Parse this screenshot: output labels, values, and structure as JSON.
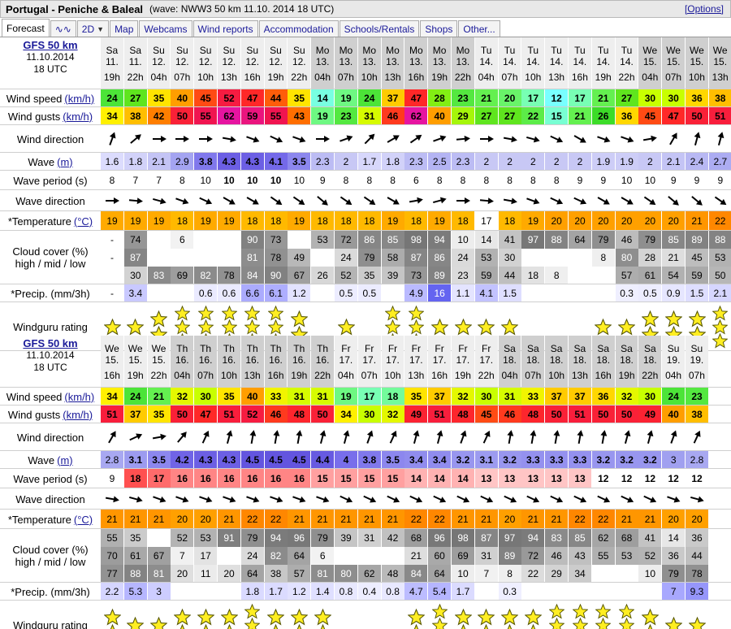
{
  "header": {
    "spot": "Portugal - Peniche & Baleal",
    "info": "(wave: NWW3 50 km 11.10. 2014 18 UTC)",
    "options": "[Options]"
  },
  "tabs": [
    {
      "label": "Forecast",
      "active": true
    },
    {
      "label": "∿∿",
      "icon": "wave-graph-icon"
    },
    {
      "label": "2D",
      "caret": true
    },
    {
      "label": "Map"
    },
    {
      "label": "Webcams"
    },
    {
      "label": "Wind reports"
    },
    {
      "label": "Accommodation"
    },
    {
      "label": "Schools/Rentals"
    },
    {
      "label": "Shops"
    },
    {
      "label": "Other..."
    }
  ],
  "labels": {
    "wind_speed": "Wind speed",
    "wind_gusts": "Wind gusts",
    "unit_kmh": "(km/h)",
    "wind_direction": "Wind direction",
    "wave": "Wave",
    "unit_m": "(m)",
    "wave_period": "Wave period (s)",
    "wave_direction": "Wave direction",
    "temperature": "*Temperature",
    "unit_c": "(°C)",
    "cloud_line1": "Cloud cover (%)",
    "cloud_line2": "high / mid / low",
    "precip": "*Precip. (mm/3h)",
    "rating": "Windguru rating"
  },
  "sections": [
    {
      "model": "GFS 50 km",
      "date": "11.10.2014",
      "utc": "18 UTC",
      "days": [
        "Sa",
        "Sa",
        "Su",
        "Su",
        "Su",
        "Su",
        "Su",
        "Su",
        "Su",
        "Mo",
        "Mo",
        "Mo",
        "Mo",
        "Mo",
        "Mo",
        "Mo",
        "Tu",
        "Tu",
        "Tu",
        "Tu",
        "Tu",
        "Tu",
        "Tu",
        "We",
        "We",
        "We",
        "We"
      ],
      "dates": [
        "11.",
        "11.",
        "12.",
        "12.",
        "12.",
        "12.",
        "12.",
        "12.",
        "12.",
        "13.",
        "13.",
        "13.",
        "13.",
        "13.",
        "13.",
        "13.",
        "14.",
        "14.",
        "14.",
        "14.",
        "14.",
        "14.",
        "14.",
        "15.",
        "15.",
        "15.",
        "15."
      ],
      "hours": [
        "19h",
        "22h",
        "04h",
        "07h",
        "10h",
        "13h",
        "16h",
        "19h",
        "22h",
        "04h",
        "07h",
        "10h",
        "13h",
        "16h",
        "19h",
        "22h",
        "04h",
        "07h",
        "10h",
        "13h",
        "16h",
        "19h",
        "22h",
        "04h",
        "07h",
        "10h",
        "13h"
      ],
      "night": [
        false,
        false,
        false,
        false,
        false,
        false,
        false,
        false,
        false,
        true,
        true,
        true,
        true,
        true,
        true,
        true,
        false,
        false,
        false,
        false,
        false,
        false,
        false,
        true,
        true,
        true,
        true
      ],
      "wind_speed": [
        24,
        27,
        35,
        40,
        45,
        52,
        47,
        44,
        35,
        14,
        19,
        24,
        37,
        47,
        28,
        23,
        21,
        20,
        17,
        12,
        17,
        21,
        27,
        30,
        30,
        36,
        38
      ],
      "wind_gusts": [
        34,
        38,
        42,
        50,
        55,
        62,
        59,
        55,
        43,
        19,
        23,
        31,
        46,
        62,
        40,
        29,
        27,
        27,
        22,
        15,
        21,
        26,
        36,
        45,
        47,
        50,
        51
      ],
      "wind_dir": [
        20,
        50,
        90,
        90,
        90,
        100,
        110,
        115,
        110,
        90,
        70,
        45,
        60,
        55,
        70,
        85,
        90,
        100,
        105,
        115,
        120,
        110,
        110,
        80,
        30,
        15,
        15
      ],
      "wave": [
        "1.6",
        "1.8",
        "2.1",
        "2.9",
        "3.8",
        "4.3",
        "4.3",
        "4.1",
        "3.5",
        "2.3",
        "2",
        "1.7",
        "1.8",
        "2.3",
        "2.5",
        "2.3",
        "2",
        "2",
        "2",
        "2",
        "2",
        "1.9",
        "1.9",
        "2",
        "2.1",
        "2.4",
        "2.7"
      ],
      "wave_bold": [
        false,
        false,
        false,
        false,
        true,
        true,
        true,
        true,
        true,
        false,
        false,
        false,
        false,
        false,
        false,
        false,
        false,
        false,
        false,
        false,
        false,
        false,
        false,
        false,
        false,
        false,
        false
      ],
      "wave_period": [
        "8",
        "7",
        "7",
        "8",
        "10",
        "10",
        "10",
        "10",
        "10",
        "9",
        "8",
        "8",
        "8",
        "6",
        "8",
        "8",
        "8",
        "8",
        "8",
        "8",
        "9",
        "9",
        "10",
        "10",
        "9",
        "9",
        "9"
      ],
      "period_bold": [
        false,
        false,
        false,
        false,
        false,
        true,
        true,
        true,
        false,
        false,
        false,
        false,
        false,
        false,
        false,
        false,
        false,
        false,
        false,
        false,
        false,
        false,
        false,
        false,
        false,
        false,
        false
      ],
      "wave_dir": [
        90,
        95,
        105,
        110,
        115,
        120,
        120,
        125,
        125,
        130,
        125,
        125,
        120,
        80,
        75,
        90,
        95,
        100,
        110,
        115,
        115,
        120,
        120,
        125,
        130,
        130,
        125
      ],
      "temperature": [
        19,
        19,
        19,
        18,
        19,
        19,
        18,
        18,
        19,
        18,
        18,
        18,
        19,
        18,
        19,
        18,
        17,
        18,
        19,
        20,
        20,
        20,
        20,
        20,
        20,
        21,
        22
      ],
      "cloud_high": [
        "-",
        "74",
        "",
        "6",
        "",
        "",
        "90",
        "73",
        "",
        "53",
        "72",
        "86",
        "85",
        "98",
        "94",
        "10",
        "14",
        "41",
        "97",
        "88",
        "64",
        "79",
        "46",
        "79",
        "85",
        "89",
        "88"
      ],
      "cloud_mid": [
        "-",
        "87",
        "",
        "",
        "",
        "",
        "81",
        "78",
        "49",
        "",
        "24",
        "79",
        "58",
        "87",
        "86",
        "24",
        "53",
        "30",
        "",
        "",
        "",
        "8",
        "80",
        "28",
        "21",
        "45",
        "53"
      ],
      "cloud_low": [
        "",
        "30",
        "83",
        "69",
        "82",
        "78",
        "84",
        "90",
        "67",
        "26",
        "52",
        "35",
        "39",
        "73",
        "89",
        "23",
        "59",
        "44",
        "18",
        "8",
        "",
        "",
        "57",
        "61",
        "54",
        "59",
        "50"
      ],
      "precip": [
        "-",
        "3.4",
        "",
        "",
        "0.6",
        "0.6",
        "6.6",
        "6.1",
        "1.2",
        "",
        "0.5",
        "0.5",
        "",
        "4.9",
        "16",
        "1.1",
        "4.1",
        "1.5",
        "",
        "",
        "",
        "",
        "0.3",
        "0.5",
        "0.9",
        "1.5",
        "2.1"
      ],
      "rating": [
        1,
        1,
        2,
        3,
        3,
        3,
        3,
        3,
        2,
        0,
        1,
        0,
        3,
        3,
        1,
        1,
        1,
        1,
        0,
        0,
        0,
        1,
        1,
        2,
        2,
        2,
        3
      ]
    },
    {
      "model": "GFS 50 km",
      "date": "11.10.2014",
      "utc": "18 UTC",
      "days": [
        "We",
        "We",
        "We",
        "Th",
        "Th",
        "Th",
        "Th",
        "Th",
        "Th",
        "Th",
        "Fr",
        "Fr",
        "Fr",
        "Fr",
        "Fr",
        "Fr",
        "Fr",
        "Sa",
        "Sa",
        "Sa",
        "Sa",
        "Sa",
        "Sa",
        "Sa",
        "Su",
        "Su"
      ],
      "dates": [
        "15.",
        "15.",
        "15.",
        "16.",
        "16.",
        "16.",
        "16.",
        "16.",
        "16.",
        "16.",
        "17.",
        "17.",
        "17.",
        "17.",
        "17.",
        "17.",
        "17.",
        "18.",
        "18.",
        "18.",
        "18.",
        "18.",
        "18.",
        "18.",
        "19.",
        "19."
      ],
      "hours": [
        "16h",
        "19h",
        "22h",
        "04h",
        "07h",
        "10h",
        "13h",
        "16h",
        "19h",
        "22h",
        "04h",
        "07h",
        "10h",
        "13h",
        "16h",
        "19h",
        "22h",
        "04h",
        "07h",
        "10h",
        "13h",
        "16h",
        "19h",
        "22h",
        "04h",
        "07h"
      ],
      "night": [
        false,
        false,
        false,
        true,
        true,
        true,
        true,
        true,
        true,
        true,
        false,
        false,
        false,
        false,
        false,
        false,
        false,
        true,
        true,
        true,
        true,
        true,
        true,
        true,
        false,
        false
      ],
      "wind_speed": [
        34,
        24,
        21,
        32,
        30,
        35,
        40,
        33,
        31,
        31,
        19,
        17,
        18,
        35,
        37,
        32,
        30,
        31,
        33,
        37,
        37,
        36,
        32,
        30,
        24,
        23
      ],
      "wind_gusts": [
        51,
        37,
        35,
        50,
        47,
        51,
        52,
        46,
        48,
        50,
        34,
        30,
        32,
        49,
        51,
        48,
        45,
        46,
        48,
        50,
        51,
        50,
        50,
        49,
        40,
        38
      ],
      "wind_dir": [
        30,
        65,
        80,
        40,
        25,
        15,
        10,
        10,
        10,
        15,
        15,
        20,
        25,
        15,
        15,
        20,
        25,
        10,
        10,
        10,
        10,
        10,
        15,
        15,
        20,
        25
      ],
      "wave": [
        "2.8",
        "3.1",
        "3.5",
        "4.2",
        "4.3",
        "4.3",
        "4.5",
        "4.5",
        "4.5",
        "4.4",
        "4",
        "3.8",
        "3.5",
        "3.4",
        "3.4",
        "3.2",
        "3.1",
        "3.2",
        "3.3",
        "3.3",
        "3.3",
        "3.2",
        "3.2",
        "3.2",
        "3",
        "2.8"
      ],
      "wave_bold": [
        false,
        true,
        true,
        true,
        true,
        true,
        true,
        true,
        true,
        true,
        true,
        true,
        true,
        true,
        true,
        true,
        true,
        true,
        true,
        true,
        true,
        true,
        true,
        true,
        false,
        false
      ],
      "wave_period": [
        "9",
        "18",
        "17",
        "16",
        "16",
        "16",
        "16",
        "16",
        "16",
        "15",
        "15",
        "15",
        "15",
        "14",
        "14",
        "14",
        "13",
        "13",
        "13",
        "13",
        "13",
        "12",
        "12",
        "12",
        "12",
        "12"
      ],
      "period_bold": [
        false,
        true,
        true,
        true,
        true,
        true,
        true,
        true,
        true,
        true,
        true,
        true,
        true,
        true,
        true,
        true,
        true,
        true,
        true,
        true,
        true,
        true,
        true,
        true,
        true,
        true
      ],
      "wave_dir": [
        100,
        105,
        110,
        110,
        110,
        110,
        110,
        110,
        110,
        110,
        115,
        115,
        115,
        115,
        115,
        115,
        115,
        115,
        115,
        115,
        115,
        115,
        115,
        115,
        110,
        105
      ],
      "temperature": [
        21,
        21,
        21,
        20,
        20,
        21,
        22,
        22,
        21,
        21,
        21,
        21,
        21,
        22,
        22,
        21,
        21,
        20,
        21,
        21,
        22,
        22,
        21,
        21,
        20,
        20
      ],
      "cloud_high": [
        "55",
        "35",
        "",
        "52",
        "53",
        "91",
        "79",
        "94",
        "96",
        "79",
        "39",
        "31",
        "42",
        "68",
        "96",
        "98",
        "87",
        "97",
        "94",
        "83",
        "85",
        "62",
        "68",
        "41",
        "14",
        "36"
      ],
      "cloud_mid": [
        "70",
        "61",
        "67",
        "7",
        "17",
        "",
        "24",
        "82",
        "64",
        "6",
        "",
        "",
        "",
        "21",
        "60",
        "69",
        "31",
        "89",
        "72",
        "46",
        "43",
        "55",
        "53",
        "52",
        "36",
        "44"
      ],
      "cloud_low": [
        "77",
        "88",
        "81",
        "20",
        "11",
        "20",
        "64",
        "38",
        "57",
        "81",
        "80",
        "62",
        "48",
        "84",
        "64",
        "10",
        "7",
        "8",
        "22",
        "29",
        "34",
        "",
        "",
        "10",
        "79",
        "78"
      ],
      "precip": [
        "2.2",
        "5.3",
        "3",
        "",
        "",
        "",
        "1.8",
        "1.7",
        "1.2",
        "1.4",
        "0.8",
        "0.4",
        "0.8",
        "4.7",
        "5.4",
        "1.7",
        "",
        "0.3",
        "",
        "",
        "",
        "",
        "",
        "",
        "7",
        "9.3"
      ],
      "rating": [
        2,
        1,
        1,
        2,
        2,
        2,
        3,
        2,
        2,
        2,
        0,
        0,
        0,
        2,
        3,
        2,
        2,
        2,
        2,
        3,
        3,
        3,
        3,
        2,
        1,
        1
      ]
    }
  ]
}
